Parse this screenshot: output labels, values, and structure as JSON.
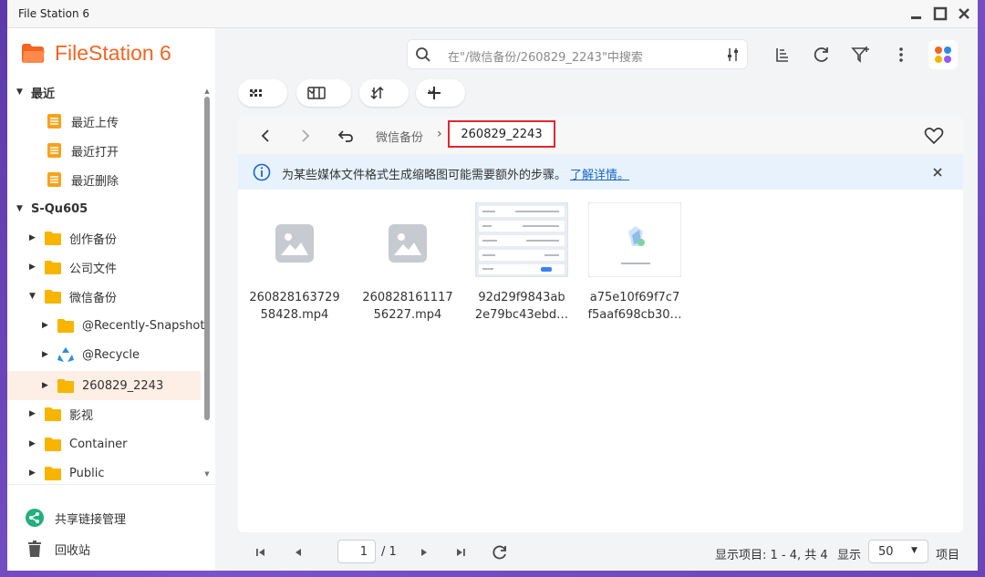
{
  "window": {
    "title": "File Station 6"
  },
  "brand": {
    "name": "FileStation 6",
    "color": "#f26522"
  },
  "sidebar": {
    "recent": {
      "label": "最近",
      "items": [
        {
          "label": "最近上传",
          "icon": "list-icon"
        },
        {
          "label": "最近打开",
          "icon": "list-icon"
        },
        {
          "label": "最近删除",
          "icon": "list-icon"
        }
      ]
    },
    "server": {
      "label": "S-Qu605",
      "folders": [
        {
          "label": "创作备份"
        },
        {
          "label": "公司文件"
        },
        {
          "label": "微信备份",
          "expanded": true
        },
        {
          "label": "@Recently-Snapshot"
        },
        {
          "label": "@Recycle"
        },
        {
          "label": "260829_2243",
          "selected": true
        },
        {
          "label": "影视"
        },
        {
          "label": "Container"
        },
        {
          "label": "Public"
        }
      ]
    },
    "bottom": {
      "share_links": "共享链接管理",
      "recycle_bin": "回收站"
    }
  },
  "search": {
    "placeholder": "在\"/微信备份/260829_2243\"中搜索"
  },
  "breadcrumb": {
    "parent": "微信备份",
    "current": "260829_2243"
  },
  "notice": {
    "message": "为某些媒体文件格式生成缩略图可能需要额外的步骤。",
    "link": "了解详情。"
  },
  "files": [
    {
      "name_line1": "260828163729",
      "name_line2": "58428.mp4",
      "thumb": "image-placeholder-icon"
    },
    {
      "name_line1": "260828161117",
      "name_line2": "56227.mp4",
      "thumb": "image-placeholder-icon"
    },
    {
      "name_line1": "92d29f9843ab",
      "name_line2": "2e79bc43ebd…",
      "thumb": "settings-screenshot"
    },
    {
      "name_line1": "a75e10f69f7c7",
      "name_line2": "f5aaf698cb30…",
      "thumb": "illustration-screenshot"
    }
  ],
  "footer": {
    "page": "1",
    "total_pages": "/ 1",
    "items_info": "显示项目: 1 - 4, 共 4",
    "show_label": "显示",
    "page_size": "50",
    "items_unit": "项目"
  },
  "colors": {
    "accent": "#f26522",
    "folder": "#f7b500",
    "highlight": "#e0282e",
    "notice_bg": "#e7f2fc"
  }
}
